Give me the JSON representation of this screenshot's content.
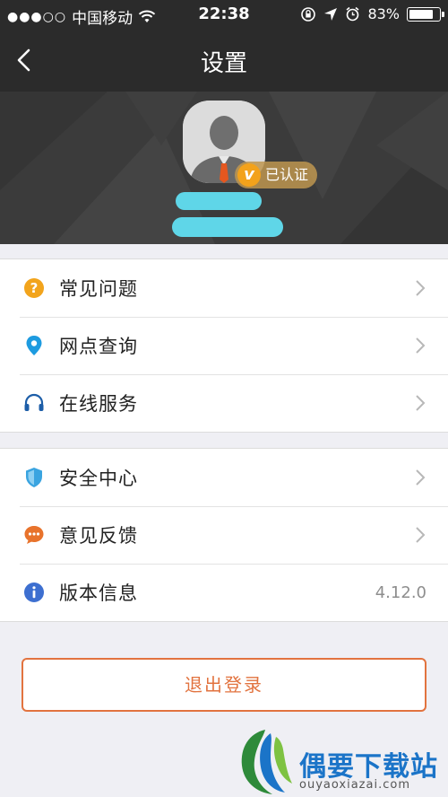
{
  "status_bar": {
    "signal_dots": "●●●○○",
    "carrier": "中国移动",
    "time": "22:38",
    "battery": "83%",
    "battery_level": 0.83
  },
  "nav": {
    "title": "设置",
    "back_icon": "chevron-left-icon"
  },
  "profile": {
    "verified_label": "已认证",
    "verified_badge": "v"
  },
  "groups": [
    {
      "items": [
        {
          "label": "常见问题",
          "icon": "question-circle-icon",
          "color": "#f2a41c"
        },
        {
          "label": "网点查询",
          "icon": "location-pin-icon",
          "color": "#1d9be0"
        },
        {
          "label": "在线服务",
          "icon": "headset-icon",
          "color": "#1d5ea8"
        }
      ]
    },
    {
      "items": [
        {
          "label": "安全中心",
          "icon": "shield-icon",
          "color": "#3aa4e0"
        },
        {
          "label": "意见反馈",
          "icon": "chat-bubble-icon",
          "color": "#e8732c"
        },
        {
          "label": "版本信息",
          "icon": "info-circle-icon",
          "color": "#3d6fd0",
          "value": "4.12.0"
        }
      ]
    }
  ],
  "logout_label": "退出登录",
  "colors": {
    "accent": "#e2733f",
    "dark_header": "#2b2b2b",
    "background": "#efeff4",
    "redaction": "#5fd6e8"
  },
  "watermark": {
    "title": "偶要下载站",
    "url": "ouyaoxiazai.com"
  }
}
